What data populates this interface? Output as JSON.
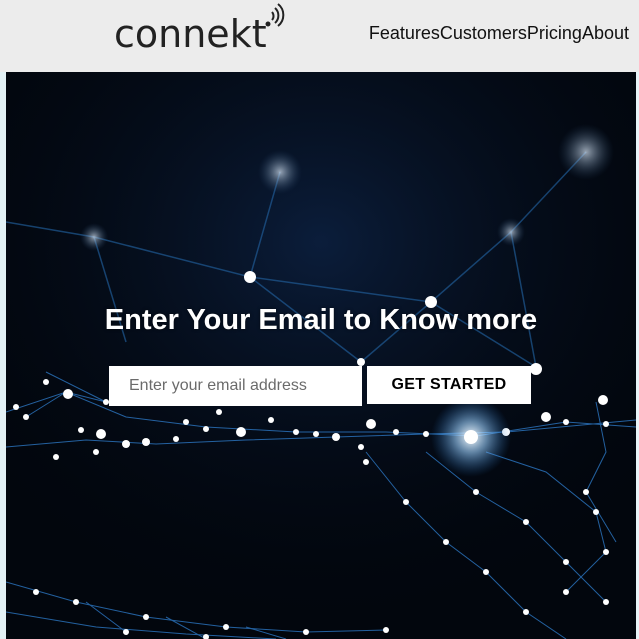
{
  "header": {
    "logo_text": "connekt",
    "nav": [
      "Features",
      "Customers",
      "Pricing",
      "About"
    ]
  },
  "hero": {
    "headline": "Enter Your Email to Know more",
    "email_placeholder": "Enter your email address",
    "cta_label": "GET STARTED"
  },
  "colors": {
    "header_bg": "#ececec",
    "hero_bg": "#02060d",
    "network_line": "#2f7fd0",
    "button_bg": "#ffffff"
  },
  "icons": [
    "wifi-signal-icon"
  ]
}
